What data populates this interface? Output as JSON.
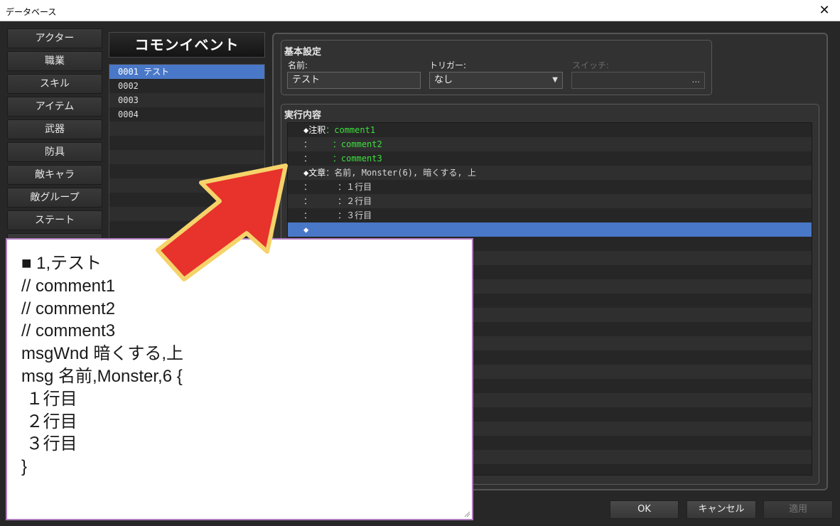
{
  "window": {
    "title": "データベース",
    "close_glyph": "✕"
  },
  "sidebar": {
    "tabs": [
      "アクター",
      "職業",
      "スキル",
      "アイテム",
      "武器",
      "防具",
      "敵キャラ",
      "敵グループ",
      "ステート"
    ]
  },
  "common_events": {
    "header": "コモンイベント",
    "items": [
      {
        "label": "0001 テスト",
        "selected": true
      },
      {
        "label": "0002",
        "selected": false
      },
      {
        "label": "0003",
        "selected": false
      },
      {
        "label": "0004",
        "selected": false
      }
    ]
  },
  "basic_settings": {
    "title": "基本設定",
    "name_label": "名前:",
    "name_value": "テスト",
    "trigger_label": "トリガー:",
    "trigger_value": "なし",
    "switch_label": "スイッチ:",
    "switch_button": "..."
  },
  "execution": {
    "title": "実行内容",
    "commands": [
      {
        "head": "◆注釈",
        "sep": "：",
        "body": "comment1",
        "kind": "comment"
      },
      {
        "head": "：",
        "sep": "    ：",
        "body": "comment2",
        "kind": "comment"
      },
      {
        "head": "：",
        "sep": "    ：",
        "body": "comment3",
        "kind": "comment"
      },
      {
        "head": "◆文章",
        "sep": "：",
        "body": "名前, Monster(6), 暗くする, 上",
        "kind": "text"
      },
      {
        "head": "：",
        "sep": "     ：",
        "body": "１行目",
        "kind": "text"
      },
      {
        "head": "：",
        "sep": "     ：",
        "body": "２行目",
        "kind": "text"
      },
      {
        "head": "：",
        "sep": "     ：",
        "body": "３行目",
        "kind": "text"
      },
      {
        "head": "◆",
        "sep": "",
        "body": "",
        "kind": "selected"
      }
    ]
  },
  "footer": {
    "ok": "OK",
    "cancel": "キャンセル",
    "apply": "適用"
  },
  "overlay_text": [
    "■ 1,テスト",
    "// comment1",
    "// comment2",
    "// comment3",
    "msgWnd 暗くする,上",
    "msg 名前,Monster,6 {",
    " １行目",
    " ２行目",
    " ３行目",
    "}"
  ],
  "colors": {
    "selection": "#4a78c8",
    "comment": "#3ee03e",
    "arrow_fill": "#e8322c",
    "arrow_outline": "#f5d36a"
  }
}
